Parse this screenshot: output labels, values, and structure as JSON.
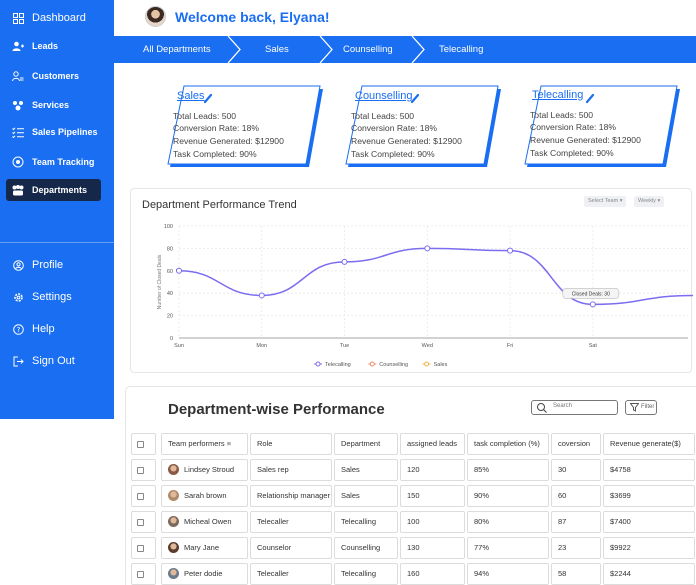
{
  "sidebar": {
    "items": [
      {
        "label": "Dashboard",
        "icon": "grid-icon"
      },
      {
        "label": "Leads",
        "icon": "user-plus-icon"
      },
      {
        "label": "Customers",
        "icon": "user-group-icon"
      },
      {
        "label": "Services",
        "icon": "services-icon"
      },
      {
        "label": "Sales Pipelines",
        "icon": "list-check-icon"
      },
      {
        "label": "Team Tracking",
        "icon": "tracking-icon"
      },
      {
        "label": "Departments",
        "icon": "departments-icon",
        "active": true
      }
    ],
    "bottom_items": [
      {
        "label": "Profile",
        "icon": "profile-icon"
      },
      {
        "label": "Settings",
        "icon": "gear-icon"
      },
      {
        "label": "Help",
        "icon": "help-icon"
      },
      {
        "label": "Sign Out",
        "icon": "sign-out-icon"
      }
    ]
  },
  "header": {
    "welcome": "Welcome back, Elyana!"
  },
  "breadcrumb": [
    "All Departments",
    "Sales",
    "Counselling",
    "Telecalling"
  ],
  "cards": [
    {
      "title": "Sales",
      "lines": [
        "Total Leads: 500",
        "Conversion Rate: 18%",
        "Revenue Generated: $12900",
        "Task Completed: 90%"
      ]
    },
    {
      "title": "Counselling",
      "lines": [
        "Total Leads: 500",
        "Conversion Rate: 18%",
        "Revenue Generated: $12900",
        "Task Completed: 90%"
      ]
    },
    {
      "title": "Telecalling",
      "lines": [
        "Total Leads: 500",
        "Conversion Rate: 18%",
        "Revenue Generated: $12900",
        "Task Completed: 90%"
      ]
    }
  ],
  "chart_panel": {
    "title": "Department Performance Trend",
    "select_team": "Select Team",
    "period": "Weekly",
    "tooltip": "Closed Deals: 30"
  },
  "chart_data": {
    "type": "line",
    "ylabel": "Number of Closed Deals",
    "ylim": [
      0,
      100
    ],
    "yticks": [
      0,
      20,
      40,
      60,
      80,
      100
    ],
    "categories": [
      "Sun",
      "Mon",
      "Tue",
      "Wed",
      "Fri",
      "Sat"
    ],
    "series": [
      {
        "name": "Telecalling",
        "values": [
          60,
          38,
          68,
          80,
          78,
          30
        ],
        "color": "#7b6cf0"
      },
      {
        "name": "Counselling",
        "values": [],
        "color": "#f08d6c"
      },
      {
        "name": "Sales",
        "values": [],
        "color": "#f2b44c"
      }
    ],
    "grid": true,
    "legend": "bottom"
  },
  "table": {
    "title": "Department-wise Performance",
    "search_placeholder": "Search",
    "filter_label": "Filter",
    "columns": [
      "Team performers",
      "Role",
      "Department",
      "assigned leads",
      "task completion (%)",
      "coversion",
      "Revenue generate($)"
    ],
    "rows": [
      [
        "Lindsey Stroud",
        "Sales rep",
        "Sales",
        "120",
        "85%",
        "30",
        "$4758"
      ],
      [
        "Sarah brown",
        "Relationship manager",
        "Sales",
        "150",
        "90%",
        "60",
        "$3699"
      ],
      [
        "Micheal Owen",
        "Telecaller",
        "Telecalling",
        "100",
        "80%",
        "87",
        "$7400"
      ],
      [
        "Mary Jane",
        "Counselor",
        "Counselling",
        "130",
        "77%",
        "23",
        "$9922"
      ],
      [
        "Peter dodie",
        "Telecaller",
        "Telecalling",
        "160",
        "94%",
        "58",
        "$2244"
      ]
    ]
  },
  "colors": {
    "primary": "#1a6ef2",
    "sidebar_active": "#16284a"
  }
}
